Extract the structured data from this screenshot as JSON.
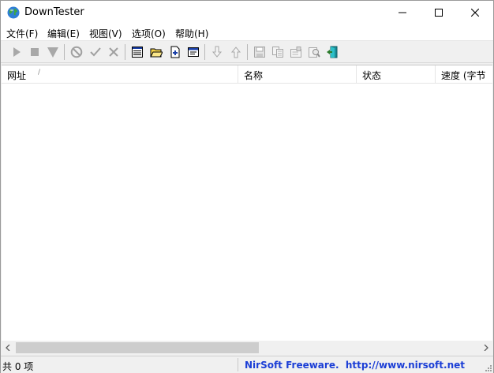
{
  "window": {
    "title": "DownTester",
    "icons": {
      "app": "globe-icon",
      "minimize": "minimize-icon",
      "maximize": "maximize-icon",
      "close": "close-icon"
    }
  },
  "menu": [
    {
      "label": "文件(F)"
    },
    {
      "label": "编辑(E)"
    },
    {
      "label": "视图(V)"
    },
    {
      "label": "选项(O)"
    },
    {
      "label": "帮助(H)"
    }
  ],
  "toolbar": {
    "buttons": [
      {
        "icon": "play-icon",
        "enabled": false
      },
      {
        "icon": "stop-icon",
        "enabled": false
      },
      {
        "icon": "down-triangle-icon",
        "enabled": false
      },
      {
        "icon": "no-entry-icon",
        "enabled": false
      },
      {
        "icon": "check-icon",
        "enabled": false
      },
      {
        "icon": "x-icon",
        "enabled": false
      },
      {
        "icon": "list-icon",
        "enabled": true
      },
      {
        "icon": "open-folder-icon",
        "enabled": true
      },
      {
        "icon": "add-document-icon",
        "enabled": true
      },
      {
        "icon": "window-icon",
        "enabled": true
      },
      {
        "icon": "arrow-down-icon",
        "enabled": false
      },
      {
        "icon": "arrow-up-icon",
        "enabled": false
      },
      {
        "icon": "save-icon",
        "enabled": false
      },
      {
        "icon": "copy-icon",
        "enabled": false
      },
      {
        "icon": "properties-icon",
        "enabled": false
      },
      {
        "icon": "search-icon",
        "enabled": false
      },
      {
        "icon": "exit-icon",
        "enabled": true
      }
    ]
  },
  "list": {
    "columns": [
      {
        "label": "网址",
        "sorted": true
      },
      {
        "label": "名称"
      },
      {
        "label": "状态"
      },
      {
        "label": "速度 (字节"
      }
    ],
    "rows": []
  },
  "status": {
    "count_text": "共 0 项",
    "link_text": "NirSoft Freeware.  http://www.nirsoft.net",
    "link_color": "#1c3fd6"
  }
}
